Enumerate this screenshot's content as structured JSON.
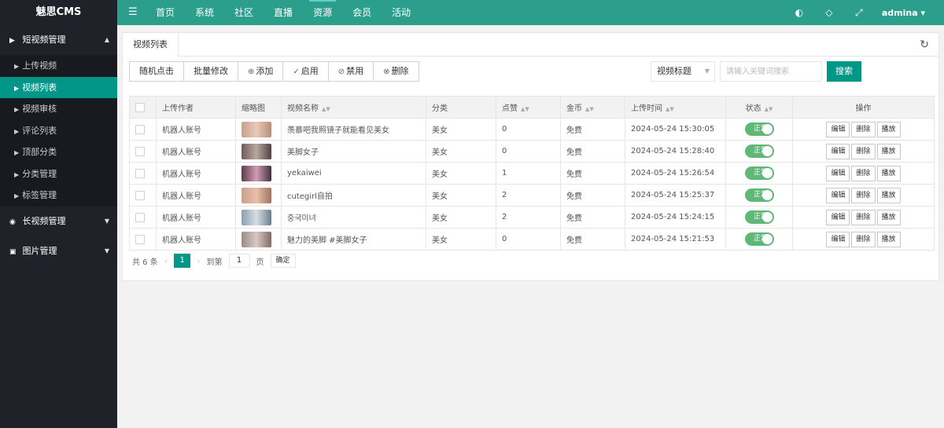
{
  "app": {
    "logo": "魅思CMS"
  },
  "topnav": {
    "items": [
      "首页",
      "系统",
      "社区",
      "直播",
      "资源",
      "会员",
      "活动"
    ],
    "active_index": 4,
    "user": "admina"
  },
  "sidebar": {
    "groups": [
      {
        "label": "短视频管理",
        "expanded": true
      },
      {
        "label": "长视频管理",
        "expanded": false
      },
      {
        "label": "图片管理",
        "expanded": false
      }
    ],
    "sub_items": [
      "上传视频",
      "视频列表",
      "视频审核",
      "评论列表",
      "顶部分类",
      "分类管理",
      "标签管理"
    ],
    "active_sub": "视频列表"
  },
  "tab": {
    "label": "视频列表"
  },
  "toolbar": {
    "random_click": "随机点击",
    "batch_edit": "批量修改",
    "add": "添加",
    "enable": "启用",
    "disable": "禁用",
    "delete": "删除",
    "search_field": "视频标题",
    "search_placeholder": "请输入关键词搜索",
    "search_button": "搜索"
  },
  "table": {
    "headers": [
      "上传作者",
      "缩略图",
      "视频名称",
      "分类",
      "点赞",
      "金币",
      "上传时间",
      "状态",
      "操作"
    ],
    "rows": [
      {
        "author": "机器人账号",
        "title": "羡慕吧我照镜子就能看见美女",
        "category": "美女",
        "likes": "0",
        "coins": "免费",
        "time": "2024-05-24 15:30:05",
        "status": "正常"
      },
      {
        "author": "机器人账号",
        "title": "美脚女子",
        "category": "美女",
        "likes": "0",
        "coins": "免费",
        "time": "2024-05-24 15:28:40",
        "status": "正常"
      },
      {
        "author": "机器人账号",
        "title": "yekaiwei",
        "category": "美女",
        "likes": "1",
        "coins": "免费",
        "time": "2024-05-24 15:26:54",
        "status": "正常"
      },
      {
        "author": "机器人账号",
        "title": "cutegirl自拍",
        "category": "美女",
        "likes": "2",
        "coins": "免费",
        "time": "2024-05-24 15:25:37",
        "status": "正常"
      },
      {
        "author": "机器人账号",
        "title": "중국미녀",
        "category": "美女",
        "likes": "2",
        "coins": "免费",
        "time": "2024-05-24 15:24:15",
        "status": "正常"
      },
      {
        "author": "机器人账号",
        "title": "魅力的美脚 #美脚女子",
        "category": "美女",
        "likes": "0",
        "coins": "免费",
        "time": "2024-05-24 15:21:53",
        "status": "正常"
      }
    ],
    "op_edit": "编辑",
    "op_delete": "删除",
    "op_play": "播放"
  },
  "pagination": {
    "total": "共 6 条",
    "current": "1",
    "goto_label": "到第",
    "goto_value": "1",
    "page_unit": "页",
    "confirm": "确定"
  },
  "colors": {
    "accent": "#009688",
    "topbar": "#2b9f8c",
    "sidebar": "#20222a",
    "switch_on": "#5fb878"
  }
}
